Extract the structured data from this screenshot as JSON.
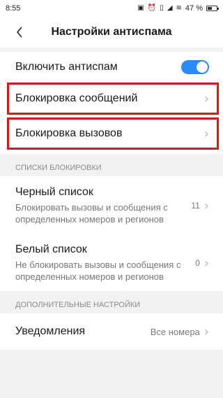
{
  "status": {
    "time": "8:55",
    "battery_text": "47 %",
    "battery_level": 0.47
  },
  "header": {
    "title": "Настройки антиспама"
  },
  "main": {
    "enable": {
      "label": "Включить антиспам",
      "on": true
    },
    "block_messages": {
      "label": "Блокировка сообщений"
    },
    "block_calls": {
      "label": "Блокировка вызовов"
    }
  },
  "lists": {
    "header": "СПИСКИ БЛОКИРОВКИ",
    "blacklist": {
      "title": "Черный список",
      "desc": "Блокировать вызовы и сообщения с определенных номеров и регионов",
      "count": "11"
    },
    "whitelist": {
      "title": "Белый список",
      "desc": "Не блокировать вызовы и сообщения с определенных номеров и регионов",
      "count": "0"
    }
  },
  "extra": {
    "header": "ДОПОЛНИТЕЛЬНЫЕ НАСТРОЙКИ",
    "notifications": {
      "label": "Уведомления",
      "value": "Все номера"
    }
  },
  "colors": {
    "accent": "#2a8af6",
    "highlight": "#e0151b"
  }
}
